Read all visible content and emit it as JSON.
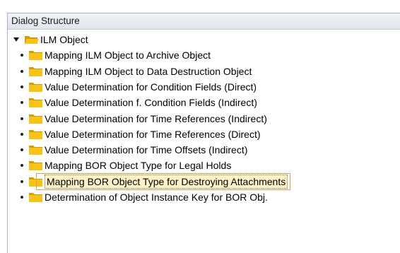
{
  "panel": {
    "title": "Dialog Structure"
  },
  "tree": {
    "root": {
      "label": "ILM Object",
      "expanded": true,
      "icon": "folder-open-icon"
    },
    "children": [
      {
        "label": "Mapping ILM Object to Archive Object",
        "selected": false
      },
      {
        "label": "Mapping ILM Object to Data Destruction Object",
        "selected": false
      },
      {
        "label": "Value Determination for Condition Fields (Direct)",
        "selected": false
      },
      {
        "label": "Value Determination f. Condition Fields (Indirect)",
        "selected": false
      },
      {
        "label": "Value Determination for Time References (Indirect)",
        "selected": false
      },
      {
        "label": "Value Determination for Time References (Direct)",
        "selected": false
      },
      {
        "label": "Value Determination for Time Offsets (Indirect)",
        "selected": false
      },
      {
        "label": "Mapping BOR Object Type for Legal Holds",
        "selected": false
      },
      {
        "label": "Mapping BOR Object Type for Destroying Attachments",
        "selected": true
      },
      {
        "label": "Determination of Object Instance Key for BOR Obj.",
        "selected": false
      }
    ]
  },
  "colors": {
    "folder": "#f5b800",
    "folder_dark": "#d89a00",
    "selection_bg": "#fdf2c7",
    "header_bg": "#e6eaf0"
  }
}
